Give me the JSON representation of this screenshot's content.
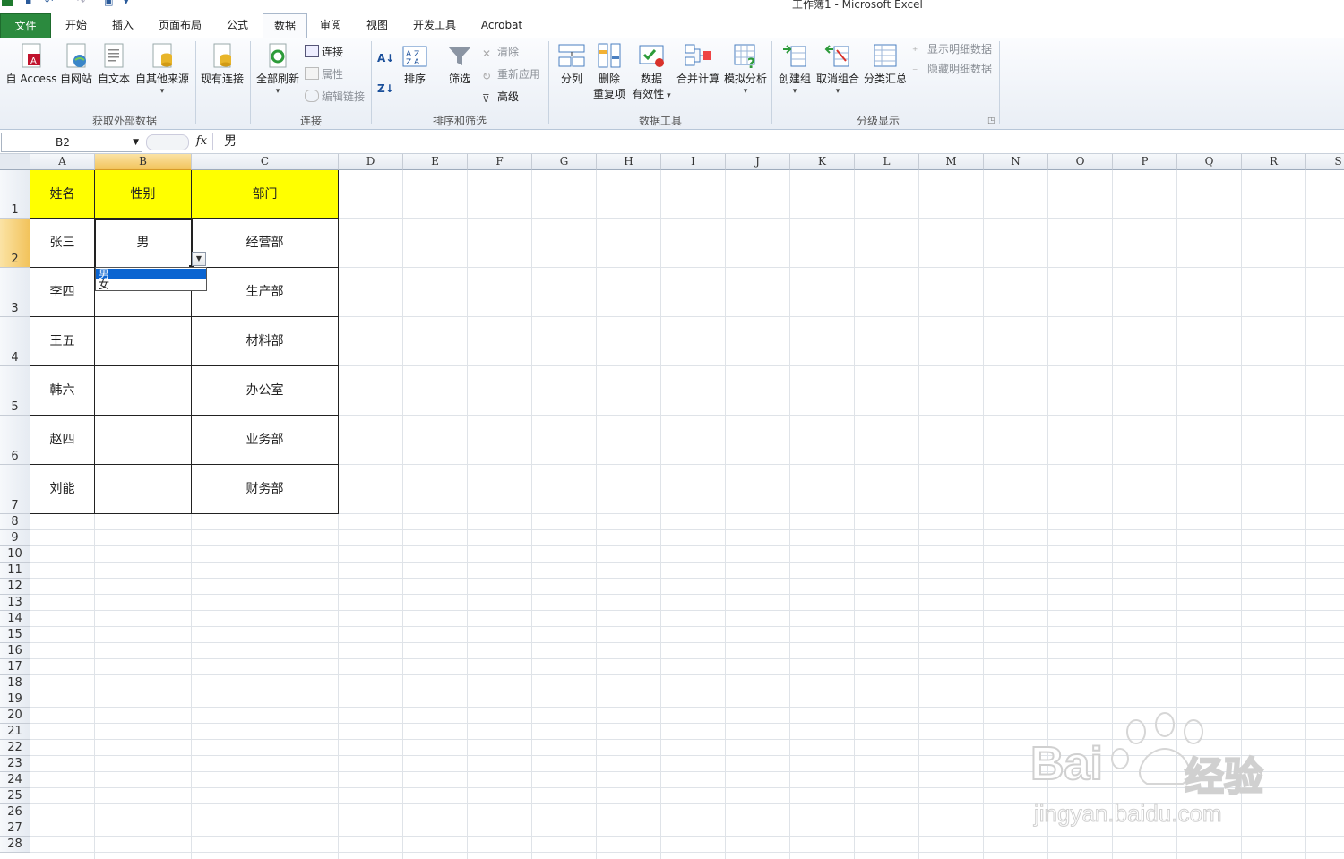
{
  "window": {
    "title": "工作簿1 - Microsoft Excel"
  },
  "tabs": [
    {
      "label": "文件"
    },
    {
      "label": "开始"
    },
    {
      "label": "插入"
    },
    {
      "label": "页面布局"
    },
    {
      "label": "公式"
    },
    {
      "label": "数据"
    },
    {
      "label": "审阅"
    },
    {
      "label": "视图"
    },
    {
      "label": "开发工具"
    },
    {
      "label": "Acrobat"
    }
  ],
  "ribbon": {
    "groups": {
      "external": "获取外部数据",
      "connections": "连接",
      "sortfilter": "排序和筛选",
      "datatools": "数据工具",
      "outline": "分级显示"
    },
    "buttons": {
      "access": "自 Access",
      "web": "自网站",
      "text": "自文本",
      "other": "自其他来源",
      "existing": "现有连接",
      "refresh": "全部刷新",
      "connections": "连接",
      "properties": "属性",
      "editlinks": "编辑链接",
      "sort": "排序",
      "filter": "筛选",
      "clear": "清除",
      "reapply": "重新应用",
      "advanced": "高级",
      "split": "分列",
      "remove_dup_1": "删除",
      "remove_dup_2": "重复项",
      "validation_1": "数据",
      "validation_2": "有效性",
      "consolidate": "合并计算",
      "whatif": "模拟分析",
      "group": "创建组",
      "ungroup": "取消组合",
      "subtotal": "分类汇总",
      "show_detail": "显示明细数据",
      "hide_detail": "隐藏明细数据"
    }
  },
  "formula_bar": {
    "name_box": "B2",
    "fx": "fx",
    "value": "男"
  },
  "columns": [
    "A",
    "B",
    "C",
    "D",
    "E",
    "F",
    "G",
    "H",
    "I",
    "J",
    "K",
    "L",
    "M",
    "N",
    "O",
    "P",
    "Q",
    "R",
    "S"
  ],
  "rows": [
    "1",
    "2",
    "3",
    "4",
    "5",
    "6",
    "7",
    "8",
    "9",
    "10",
    "11",
    "12",
    "13",
    "14",
    "15",
    "16",
    "17",
    "18",
    "19",
    "20",
    "21",
    "22",
    "23",
    "24",
    "25",
    "26",
    "27",
    "28"
  ],
  "cells": {
    "header": [
      "姓名",
      "性别",
      "部门"
    ],
    "names": [
      "张三",
      "李四",
      "王五",
      "韩六",
      "赵四",
      "刘能"
    ],
    "gender": [
      "男",
      "",
      "",
      "",
      "",
      ""
    ],
    "depts": [
      "经营部",
      "生产部",
      "材料部",
      "办公室",
      "业务部",
      "财务部"
    ]
  },
  "dropdown": {
    "options": [
      "男",
      "女"
    ],
    "selected": 0
  },
  "watermark": {
    "brand": "Bai",
    "cn": "经验",
    "url": "jingyan.baidu.com"
  },
  "colors": {
    "header_fill": "#ffff00",
    "file_tab": "#2b8a3e",
    "selection": "#0a64d1"
  }
}
